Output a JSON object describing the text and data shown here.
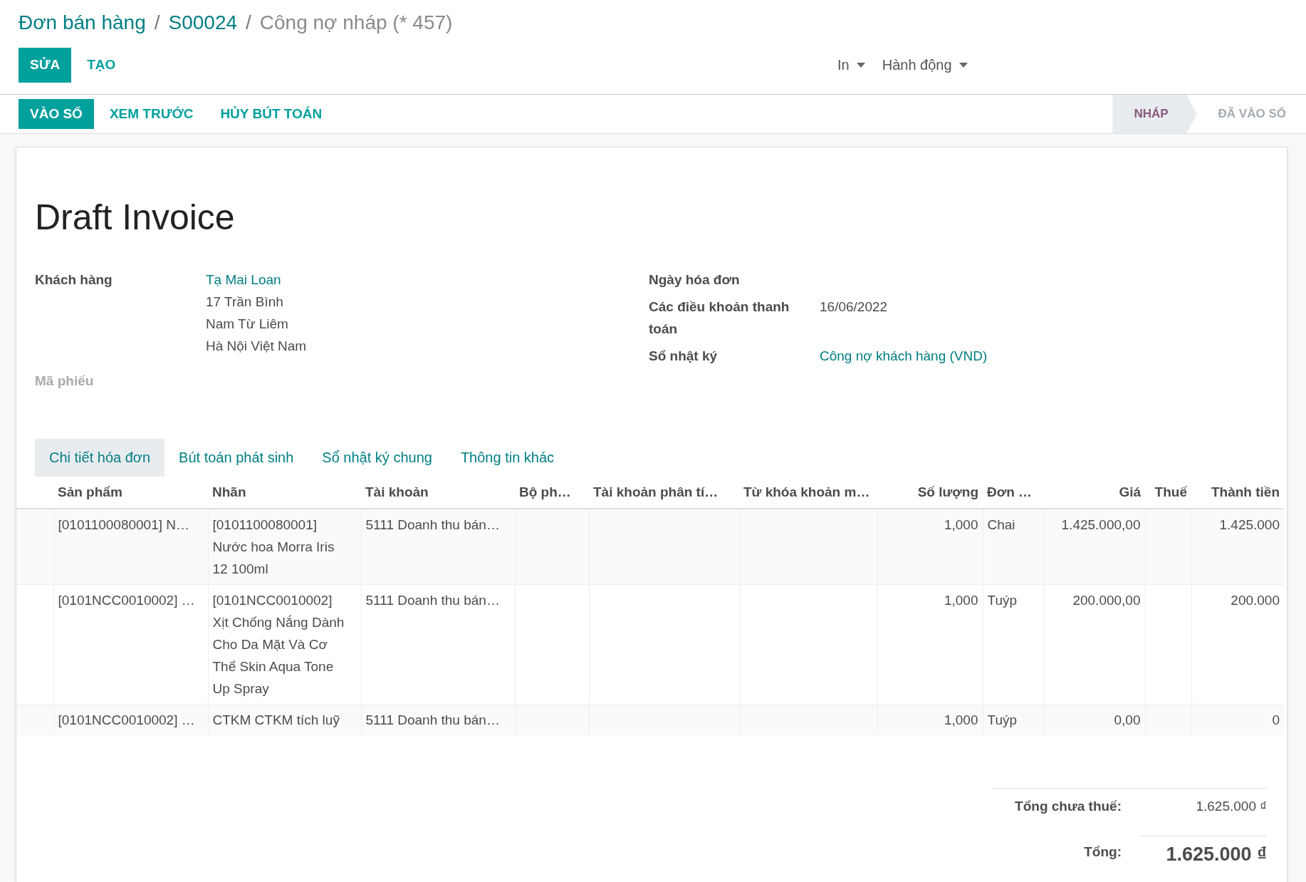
{
  "breadcrumbs": {
    "separator": "/",
    "items": [
      {
        "label": "Đơn bán hàng",
        "current": false
      },
      {
        "label": "S00024",
        "current": false
      },
      {
        "label": "Công nợ nháp (* 457)",
        "current": true
      }
    ]
  },
  "toolbar": {
    "buttons": [
      {
        "label": "SỬA",
        "primary": true
      },
      {
        "label": "TẠO",
        "primary": false
      }
    ],
    "dropdowns": [
      "In",
      "Hành động"
    ]
  },
  "status_bar": {
    "buttons": [
      {
        "label": "VÀO SỔ",
        "primary": true
      },
      {
        "label": "XEM TRƯỚC",
        "primary": false
      },
      {
        "label": "HỦY BÚT TOÁN",
        "primary": false
      }
    ],
    "stages": [
      {
        "label": "NHÁP",
        "selected": true
      },
      {
        "label": "ĐÃ VÀO SỔ",
        "selected": false
      }
    ]
  },
  "sheet": {
    "title": "Draft Invoice",
    "customer": {
      "label": "Khách hàng",
      "name": "Tạ Mai Loan",
      "address": [
        "17 Trần Bình",
        "Nam Từ Liêm",
        "Hà Nội Việt Nam"
      ]
    },
    "reference": {
      "label": "Mã phiếu"
    },
    "right_fields": [
      {
        "label": "Ngày hóa đơn",
        "kind": "empty"
      },
      {
        "label": "Các điều khoản thanh toán",
        "value": "16/06/2022",
        "kind": "text"
      },
      {
        "label": "Sổ nhật ký",
        "value": "Công nợ khách hàng (VND)",
        "kind": "link"
      }
    ],
    "tabs": [
      {
        "label": "Chi tiết hóa đơn",
        "selected": true
      },
      {
        "label": "Bút toán phát sinh",
        "selected": false
      },
      {
        "label": "Sổ nhật ký chung",
        "selected": false
      },
      {
        "label": "Thông tin khác",
        "selected": false
      }
    ],
    "table": {
      "columns": [
        {
          "label": "Sản phẩm",
          "kind": "text"
        },
        {
          "label": "Nhãn",
          "kind": "text"
        },
        {
          "label": "Tài khoản",
          "kind": "text"
        },
        {
          "label": "Bộ ph…",
          "kind": "text"
        },
        {
          "label": "Tài khoản phân tí…",
          "kind": "text"
        },
        {
          "label": "Từ khóa khoản m…",
          "kind": "text"
        },
        {
          "label": "Số lượng",
          "kind": "number"
        },
        {
          "label": "Đơn …",
          "kind": "text"
        },
        {
          "label": "Giá",
          "kind": "number"
        },
        {
          "label": "Thuế",
          "kind": "number"
        },
        {
          "label": "Thành tiền",
          "kind": "number"
        }
      ],
      "rows": [
        {
          "cells": [
            "[0101100080001] N…",
            "[0101100080001] Nước hoa Morra Iris 12 100ml",
            "5111 Doanh thu bán…",
            "",
            "",
            "",
            "1,000",
            "Chai",
            "1.425.000,00",
            "",
            "1.425.000"
          ]
        },
        {
          "cells": [
            "[0101NCC0010002] …",
            "[0101NCC0010002] Xịt Chống Nắng Dành Cho Da Mặt Và Cơ Thể Skin Aqua Tone Up Spray",
            "5111 Doanh thu bán…",
            "",
            "",
            "",
            "1,000",
            "Tuýp",
            "200.000,00",
            "",
            "200.000"
          ]
        },
        {
          "cells": [
            "[0101NCC0010002] …",
            "CTKM CTKM tích luỹ",
            "5111 Doanh thu bán…",
            "",
            "",
            "",
            "1,000",
            "Tuýp",
            "0,00",
            "",
            "0"
          ]
        }
      ]
    },
    "totals": [
      {
        "label": "Tổng chưa thuế:",
        "value": "1.625.000 ₫",
        "kind": "subtotal"
      },
      {
        "label": "Tổng:",
        "value": "1.625.000 ₫",
        "kind": "total"
      }
    ]
  }
}
